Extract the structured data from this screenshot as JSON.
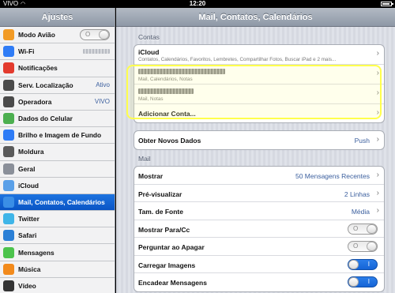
{
  "status": {
    "carrier": "VIVO",
    "time": "12:20"
  },
  "sidebar": {
    "title": "Ajustes",
    "items": [
      {
        "label": "Modo Avião",
        "icon": "airplane-icon",
        "color": "#f29b26",
        "toggle": "O"
      },
      {
        "label": "Wi-Fi",
        "icon": "wifi-icon",
        "color": "#2f7cf6"
      },
      {
        "label": "Notificações",
        "icon": "notifications-icon",
        "color": "#e33b2e"
      },
      {
        "label": "Serv. Localização",
        "value": "Ativo",
        "icon": "location-icon",
        "color": "#4a4a4a"
      },
      {
        "label": "Operadora",
        "value": "VIVO",
        "icon": "carrier-icon",
        "color": "#4a4a4a"
      },
      {
        "label": "Dados do Celular",
        "icon": "cellular-icon",
        "color": "#4caf50"
      },
      {
        "label": "Brilho e Imagem de Fundo",
        "icon": "brightness-icon",
        "color": "#2f7cf6"
      },
      {
        "label": "Moldura",
        "icon": "frame-icon",
        "color": "#5a5a5a"
      },
      {
        "label": "Geral",
        "icon": "gear-icon",
        "color": "#8a8f99"
      },
      {
        "label": "iCloud",
        "icon": "cloud-icon",
        "color": "#5aa0e8"
      },
      {
        "label": "Mail, Contatos, Calendários",
        "icon": "mail-icon",
        "color": "#3a8ee6",
        "selected": true
      },
      {
        "label": "Twitter",
        "icon": "twitter-icon",
        "color": "#3fb5e8"
      },
      {
        "label": "Safari",
        "icon": "safari-icon",
        "color": "#2a7fd6"
      },
      {
        "label": "Mensagens",
        "icon": "messages-icon",
        "color": "#4cc34c"
      },
      {
        "label": "Música",
        "icon": "music-icon",
        "color": "#f28a1c"
      },
      {
        "label": "Vídeo",
        "icon": "video-icon",
        "color": "#333333"
      }
    ]
  },
  "main": {
    "title": "Mail, Contatos, Calendários",
    "contas_label": "Contas",
    "icloud_title": "iCloud",
    "icloud_sub": "Contatos, Calendários, Favoritos, Lembretes, Compartilhar Fotos, Buscar iPad e 2 mais...",
    "account1_sub": "Mail, Calendários, Notas",
    "account2_sub": "Mail, Notas",
    "add_account": "Adicionar Conta...",
    "fetch_label": "Obter Novos Dados",
    "fetch_value": "Push",
    "mail_label": "Mail",
    "rows": [
      {
        "label": "Mostrar",
        "value": "50 Mensagens Recentes"
      },
      {
        "label": "Pré-visualizar",
        "value": "2 Linhas"
      },
      {
        "label": "Tam. de Fonte",
        "value": "Média"
      },
      {
        "label": "Mostrar Para/Cc",
        "toggle": "O"
      },
      {
        "label": "Perguntar ao Apagar",
        "toggle": "O"
      },
      {
        "label": "Carregar Imagens",
        "toggle": "I"
      },
      {
        "label": "Encadear Mensagens",
        "toggle": "I"
      }
    ]
  },
  "colors": {
    "highlight": "#ffff4d",
    "selection": "#0f5fcf"
  }
}
